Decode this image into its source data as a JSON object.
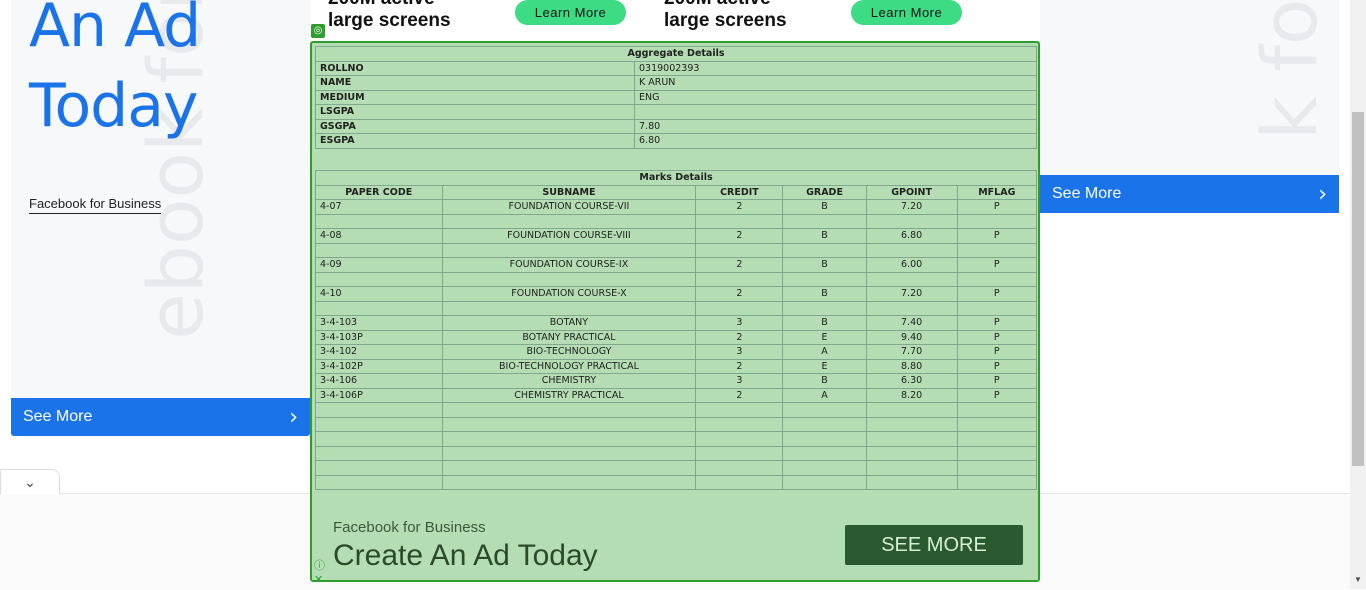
{
  "left_ad": {
    "headline_1": "An Ad",
    "headline_2": "Today",
    "watermark": "ebook for",
    "brand": "Facebook for Business",
    "see_more": "See More"
  },
  "right_ad": {
    "watermark": "k for",
    "see_more": "See More"
  },
  "top_strip": {
    "line_a": "200M active",
    "line_b": "large screens",
    "learn_more": "Learn More"
  },
  "overlay": {
    "aggregate": {
      "title": "Aggregate Details",
      "rows": [
        {
          "k": "ROLLNO",
          "v": "0319002393"
        },
        {
          "k": "NAME",
          "v": "K ARUN"
        },
        {
          "k": "MEDIUM",
          "v": "ENG"
        },
        {
          "k": "LSGPA",
          "v": ""
        },
        {
          "k": "GSGPA",
          "v": "7.80"
        },
        {
          "k": "ESGPA",
          "v": "6.80"
        }
      ]
    },
    "marks": {
      "title": "Marks Details",
      "headers": [
        "PAPER CODE",
        "SUBNAME",
        "CREDIT",
        "GRADE",
        "GPOINT",
        "MFLAG"
      ],
      "rows": [
        [
          "4-07",
          "FOUNDATION COURSE-VII",
          "2",
          "B",
          "7.20",
          "P"
        ],
        [
          "",
          "",
          "",
          "",
          "",
          ""
        ],
        [
          "4-08",
          "FOUNDATION COURSE-VIII",
          "2",
          "B",
          "6.80",
          "P"
        ],
        [
          "",
          "",
          "",
          "",
          "",
          ""
        ],
        [
          "4-09",
          "FOUNDATION COURSE-IX",
          "2",
          "B",
          "6.00",
          "P"
        ],
        [
          "",
          "",
          "",
          "",
          "",
          ""
        ],
        [
          "4-10",
          "FOUNDATION COURSE-X",
          "2",
          "B",
          "7.20",
          "P"
        ],
        [
          "",
          "",
          "",
          "",
          "",
          ""
        ],
        [
          "3-4-103",
          "BOTANY",
          "3",
          "B",
          "7.40",
          "P"
        ],
        [
          "3-4-103P",
          "BOTANY PRACTICAL",
          "2",
          "E",
          "9.40",
          "P"
        ],
        [
          "3-4-102",
          "BIO-TECHNOLOGY",
          "3",
          "A",
          "7.70",
          "P"
        ],
        [
          "3-4-102P",
          "BIO-TECHNOLOGY PRACTICAL",
          "2",
          "E",
          "8.80",
          "P"
        ],
        [
          "3-4-106",
          "CHEMISTRY",
          "3",
          "B",
          "6.30",
          "P"
        ],
        [
          "3-4-106P",
          "CHEMISTRY PRACTICAL",
          "2",
          "A",
          "8.20",
          "P"
        ],
        [
          "",
          "",
          "",
          "",
          "",
          ""
        ],
        [
          "",
          "",
          "",
          "",
          "",
          ""
        ],
        [
          "",
          "",
          "",
          "",
          "",
          ""
        ],
        [
          "",
          "",
          "",
          "",
          "",
          ""
        ],
        [
          "",
          "",
          "",
          "",
          "",
          ""
        ],
        [
          "",
          "",
          "",
          "",
          "",
          ""
        ]
      ]
    },
    "ad": {
      "brand": "Facebook for Business",
      "title": "Create An Ad Today",
      "button": "SEE MORE"
    }
  },
  "colors": {
    "fb_blue": "#1a73e8",
    "overlay_green": "#b4ddb3",
    "border_green": "#2e9d2e",
    "learn_more_green": "#3ddc84"
  }
}
